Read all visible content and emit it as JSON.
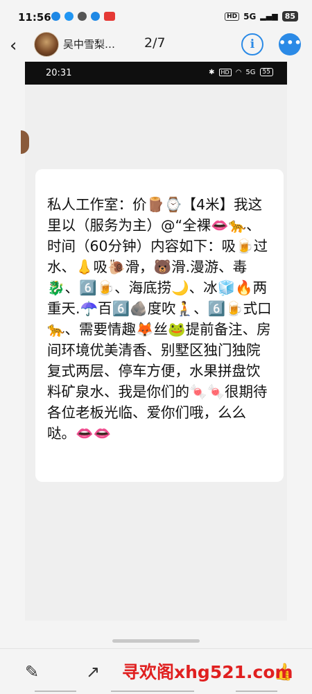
{
  "status_bar": {
    "time": "11:56",
    "notification_colors": [
      "#1e88e5",
      "#2196f3",
      "#555555",
      "#1e88e5",
      "#e53935"
    ],
    "network": "HD",
    "signal": "5G",
    "battery": "85"
  },
  "header": {
    "back_icon": "chevron-left-icon",
    "contact_name": "吴中雪梨…",
    "page_indicator": "2/7",
    "info_icon": "i",
    "more_icon": "•••"
  },
  "embedded_screenshot": {
    "status_time": "20:31",
    "status_network": "HD",
    "status_signal": "5G",
    "status_battery": "55",
    "message": "私人工作室：价🪵⌚【4米】我这里以（服务为主）@“全裸👄🐆、时间（60分钟）内容如下：吸🍺过水、👃吸🐌滑，🐻滑.漫游、毒🐉、6️⃣🍺、海底捞🌙、冰🧊🔥两重天.☂️百6️⃣🪨度吹🧎、6️⃣🍺式口🐆、需要情趣🦊丝🐸提前备注、房间环境优美清香、别墅区独门独院复式两层、停车方便，水果拼盘饮料矿泉水、我是你们的🍬🍬很期待各位老板光临、爱你们哦，么么哒。👄👄"
  },
  "toolbar": {
    "edit_icon": "pencil-icon",
    "share_icon": "share-icon",
    "like_icon": "thumbs-up-icon"
  },
  "watermark": "寻欢阁xhg521.com",
  "colors": {
    "accent": "#2b8ae6",
    "watermark": "#e02020"
  }
}
